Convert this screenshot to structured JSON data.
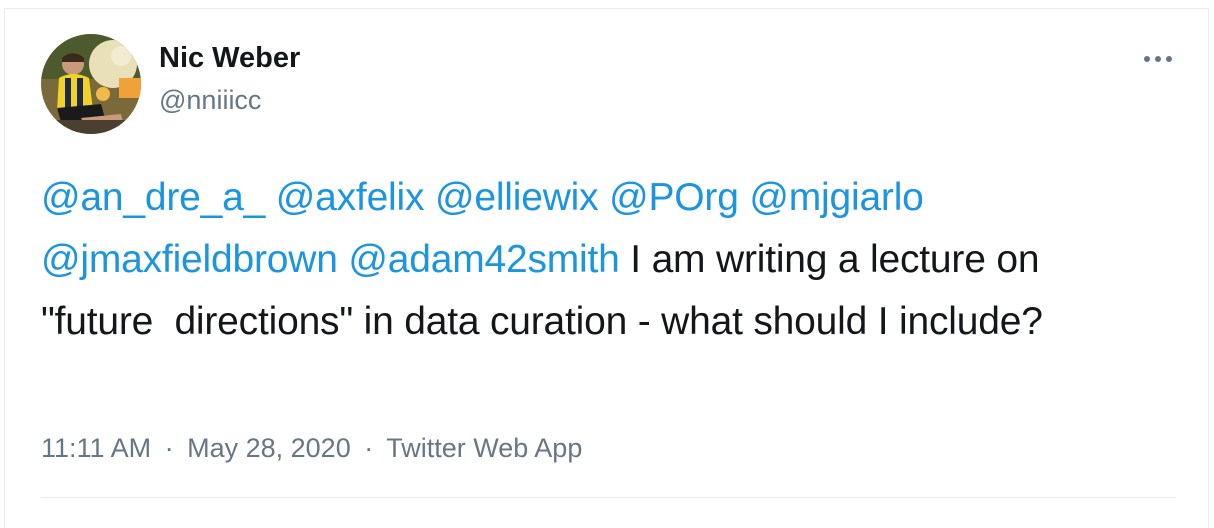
{
  "author": {
    "name": "Nic Weber",
    "handle": "@nniiicc"
  },
  "more_icon": "more-horizontal-icon",
  "tweet": {
    "mentions": [
      "@an_dre_a_",
      "@axfelix",
      "@elliewix",
      "@POrg",
      "@mjgiarlo",
      "@jmaxfieldbrown",
      "@adam42smith"
    ],
    "text": "I am writing a lecture on \"future  directions\" in data curation - what should I include?"
  },
  "meta": {
    "time": "11:11 AM",
    "date": "May 28, 2020",
    "separator": "·",
    "source": "Twitter Web App"
  },
  "colors": {
    "mention": "#1b95e0",
    "text": "#14171a",
    "muted": "#657786",
    "border": "#e6ecf0"
  }
}
